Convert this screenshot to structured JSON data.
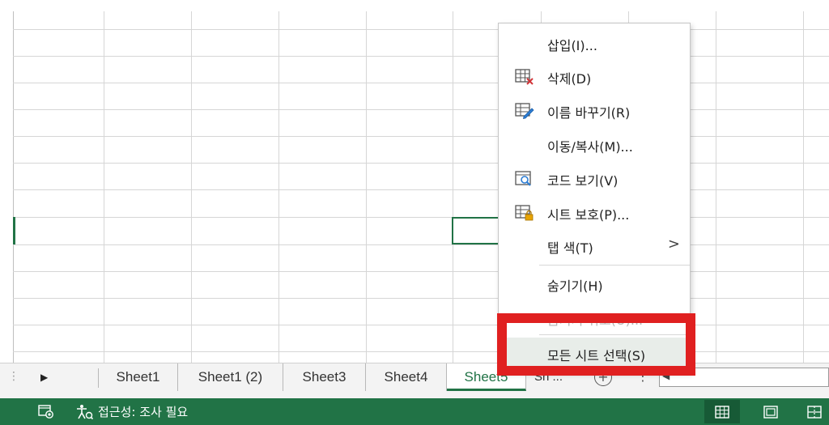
{
  "sheet_tabs": {
    "tabs": [
      {
        "label": "Sheet1",
        "active": false
      },
      {
        "label": "Sheet1 (2)",
        "active": false
      },
      {
        "label": "Sheet3",
        "active": false
      },
      {
        "label": "Sheet4",
        "active": false
      },
      {
        "label": "Sheet5",
        "active": true
      }
    ],
    "more_tabs_label": "Sh ...",
    "add_sheet_glyph": "+",
    "options_glyph": "⋮",
    "scroll_left_glyph": "◀"
  },
  "status_bar": {
    "accessibility_text": "접근성: 조사 필요",
    "accent_color": "#217346",
    "view_icons": [
      "normal-view-icon",
      "page-layout-view-icon",
      "page-break-view-icon"
    ]
  },
  "context_menu": {
    "items": [
      {
        "label": "삽입(I)...",
        "icon": null,
        "disabled": false
      },
      {
        "label": "삭제(D)",
        "icon": "delete-sheet-icon",
        "disabled": false
      },
      {
        "label": "이름 바꾸기(R)",
        "icon": "rename-sheet-icon",
        "disabled": false
      },
      {
        "label": "이동/복사(M)...",
        "icon": null,
        "disabled": false
      },
      {
        "label": "코드 보기(V)",
        "icon": "view-code-icon",
        "disabled": false
      },
      {
        "label": "시트 보호(P)...",
        "icon": "protect-sheet-icon",
        "disabled": false
      },
      {
        "label": "탭 색(T)",
        "icon": null,
        "disabled": false,
        "submenu": true
      },
      {
        "label": "숨기기(H)",
        "icon": null,
        "disabled": false
      },
      {
        "label": "숨기기 취소(U)...",
        "icon": null,
        "disabled": true
      },
      {
        "label": "모든 시트 선택(S)",
        "icon": null,
        "disabled": false,
        "hovered": true
      }
    ],
    "submenu_glyph": ">"
  },
  "highlight_color": "#e02020"
}
